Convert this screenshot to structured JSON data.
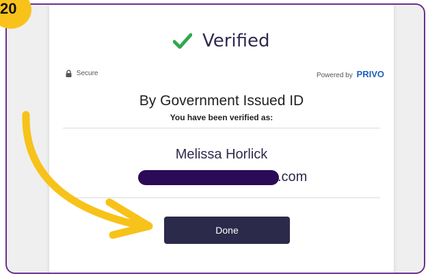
{
  "step_badge": "20",
  "header": {
    "title": "Verified",
    "status_icon": "check-icon",
    "check_color": "#2fa84f"
  },
  "security": {
    "secure_label": "Secure",
    "powered_by_label": "Powered by",
    "brand": "PRIVO"
  },
  "verification": {
    "method": "By Government Issued ID",
    "subtitle": "You have been verified as:",
    "name": "Melissa Horlick",
    "email_suffix": ".com"
  },
  "actions": {
    "done_label": "Done"
  },
  "colors": {
    "frame": "#6b2f8f",
    "badge": "#f9c21b",
    "arrow": "#f7c21a",
    "button": "#2c2a4a",
    "brand": "#1f5fbf",
    "redaction": "#2b0a57"
  }
}
